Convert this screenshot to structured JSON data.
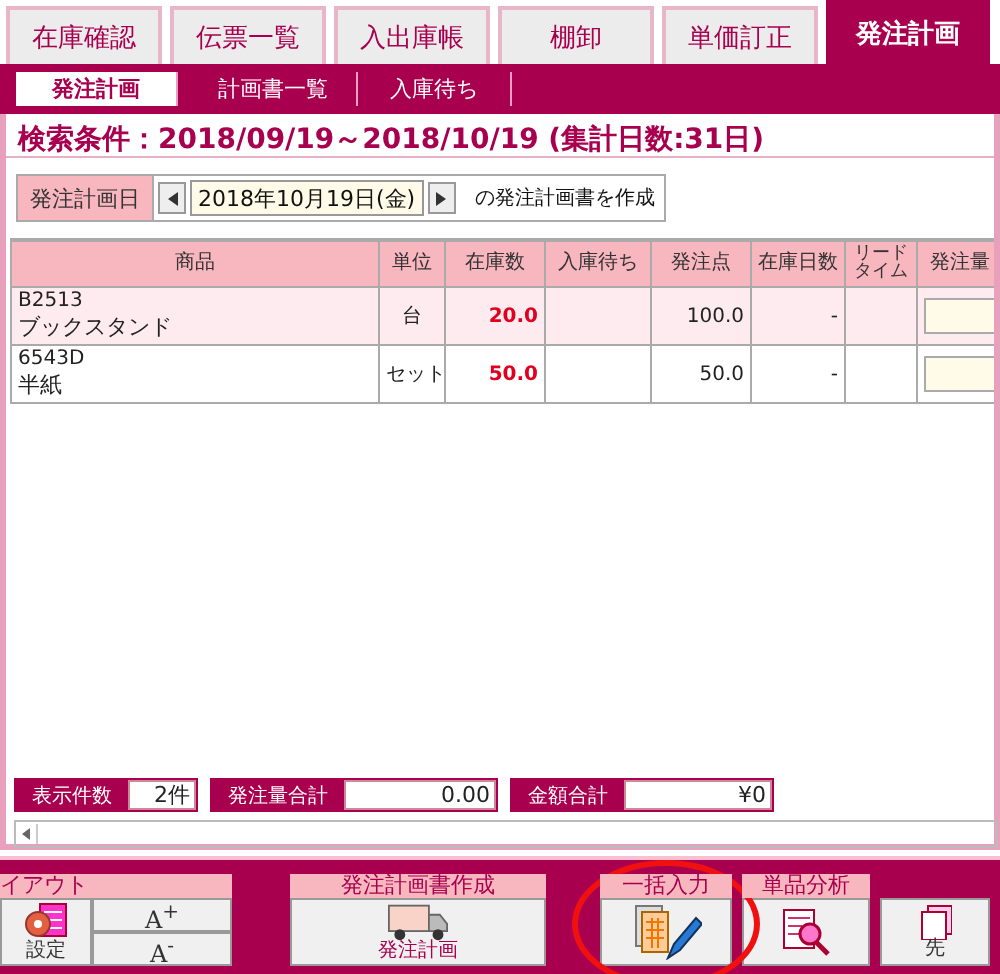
{
  "tabs": [
    {
      "label": "在庫確認",
      "selected": false
    },
    {
      "label": "伝票一覧",
      "selected": false
    },
    {
      "label": "入出庫帳",
      "selected": false
    },
    {
      "label": "棚卸",
      "selected": false
    },
    {
      "label": "単価訂正",
      "selected": false
    },
    {
      "label": "発注計画",
      "selected": true
    }
  ],
  "subtabs": [
    {
      "label": "発注計画",
      "selected": true
    },
    {
      "label": "計画書一覧",
      "selected": false
    },
    {
      "label": "入庫待ち",
      "selected": false
    }
  ],
  "search_condition": "検索条件：2018/09/19～2018/10/19 (集計日数:31日)",
  "plan_date": {
    "label": "発注計画日",
    "value": "2018年10月19日(金)",
    "suffix": "の発注計画書を作成"
  },
  "table": {
    "columns": [
      "商品",
      "単位",
      "在庫数",
      "入庫待ち",
      "発注点",
      "在庫日数",
      "リードタイム",
      "発注量"
    ],
    "rows": [
      {
        "code": "B2513",
        "name": "ブックスタンド",
        "unit": "台",
        "stock": "20.0",
        "order_point": "100.0",
        "stock_days": "-"
      },
      {
        "code": "6543D",
        "name": "半紙",
        "unit": "セット",
        "stock": "50.0",
        "order_point": "50.0",
        "stock_days": "-"
      }
    ]
  },
  "summary": [
    {
      "label": "表示件数",
      "value": "2件"
    },
    {
      "label": "発注量合計",
      "value": "0.00"
    },
    {
      "label": "金額合計",
      "value": "¥0"
    }
  ],
  "toolbar": [
    {
      "title": "イアウト",
      "buttons": [
        {
          "kind": "settings",
          "label": "設定"
        },
        {
          "kind": "font_up",
          "label": "A$^{+}$"
        },
        {
          "kind": "font_down",
          "label": "A$^{-}$"
        }
      ],
      "highlighted": false
    },
    {
      "title": "発注計画書作成",
      "buttons": [
        {
          "kind": "truck",
          "label": "発注計画"
        }
      ],
      "highlighted": false
    },
    {
      "title": "一括入力",
      "buttons": [
        {
          "kind": "bulk"
        }
      ],
      "highlighted": true
    },
    {
      "title": "単品分析",
      "buttons": [
        {
          "kind": "analysis"
        }
      ],
      "highlighted": false
    },
    {
      "buttons": [
        {
          "kind": "papers",
          "label": "先"
        }
      ],
      "highlighted": false
    }
  ]
}
